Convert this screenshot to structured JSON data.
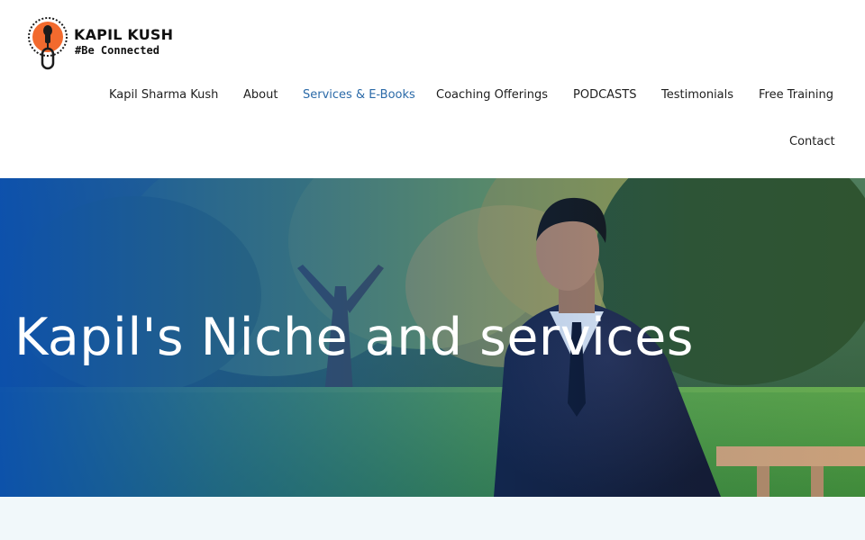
{
  "brand": {
    "title": "KAPIL KUSH",
    "tagline": "#Be Connected",
    "colors": {
      "accent": "#f26a2e",
      "dark": "#1c1c1c"
    },
    "icon": "microphone-with-cable-icon"
  },
  "nav": {
    "items": [
      {
        "label": "Kapil Sharma Kush"
      },
      {
        "label": "About"
      },
      {
        "label": "Services & E-Books",
        "active": true
      },
      {
        "label": "Coaching Offerings"
      },
      {
        "label": "PODCASTS"
      },
      {
        "label": "Testimonials"
      },
      {
        "label": "Free Training"
      },
      {
        "label": "Contact"
      }
    ],
    "active_color": "#2b6aa8",
    "text_color": "#1e1e1e"
  },
  "hero": {
    "title": "Kapil's Niche and services",
    "overlay_color": "#0a4fb0",
    "image": "man-in-suit-seated-in-park-photo"
  },
  "section_below": {
    "background": "#f1f8fa"
  }
}
